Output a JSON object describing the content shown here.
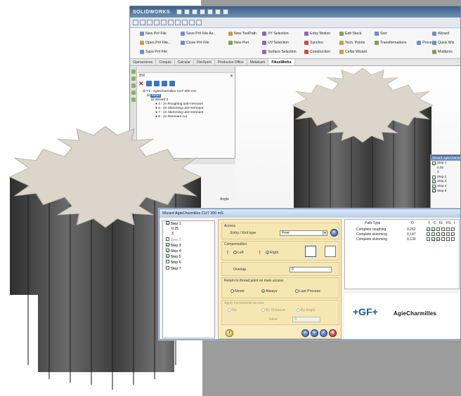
{
  "app": {
    "brand": "SOLIDWORKS"
  },
  "ribbon": {
    "items": [
      {
        "label": "New Pr# File"
      },
      {
        "label": "Save Pr# File As..."
      },
      {
        "label": "New ToolPath"
      },
      {
        "label": "XY Selection"
      },
      {
        "label": "Entry Motion"
      },
      {
        "label": "Edit Stock"
      },
      {
        "label": "Sort"
      },
      {
        "label": "Wizard"
      },
      {
        "label": "Open Pr# File..."
      },
      {
        "label": "Close Pr# File"
      },
      {
        "label": "New Part"
      },
      {
        "label": "UV Selection"
      },
      {
        "label": "Synchro"
      },
      {
        "label": "Tech. Points"
      },
      {
        "label": "Transformations"
      },
      {
        "label": "Process"
      },
      {
        "label": "Quick Wiz"
      },
      {
        "label": "Save Pr# File"
      },
      {
        "label": "Surface Selection"
      },
      {
        "label": "Construction"
      },
      {
        "label": "Cellar Wizard"
      },
      {
        "label": "Multiproc"
      }
    ]
  },
  "tabs": [
    {
      "label": "Operaciones"
    },
    {
      "label": "Croquis"
    },
    {
      "label": "Calcular"
    },
    {
      "label": "DimXpert"
    },
    {
      "label": "Productos Office"
    },
    {
      "label": "Metalcam"
    },
    {
      "label": "FikusWorks",
      "active": true
    }
  ],
  "tree": {
    "caption": "BW",
    "items": [
      {
        "label": "T1 - AgieCharmilles CUT 300 mS",
        "level": 0
      },
      {
        "label": "Step1",
        "level": 1
      },
      {
        "label": "Wizard 3",
        "level": 2
      },
      {
        "label": "4 - 2n Roughing unit+remnant",
        "level": 3
      },
      {
        "label": "5 - 2n Skimming unit+remnant",
        "level": 3
      },
      {
        "label": "7 - 2n Skimming unit+remnant",
        "level": 3
      },
      {
        "label": "8 - 2n Remnant cut",
        "level": 3
      }
    ]
  },
  "inspector": {
    "caption": "Inspector",
    "tab": "Details",
    "angle_label": "Angle"
  },
  "mini_wizard": {
    "title": "Wizard AgieCharmilles CUT 300 mS",
    "steps": [
      {
        "label": "Step 1",
        "checked": true
      },
      {
        "label": "0,25"
      },
      {
        "label": "3"
      },
      {
        "label": "Step 2",
        "dim": true
      },
      {
        "label": "Step 3",
        "checked": true
      },
      {
        "label": "Step 4",
        "checked": true
      },
      {
        "label": "Step 5",
        "checked": true
      }
    ]
  },
  "wizard": {
    "title": "Wizard AgieCharmilles CUT 300 mS",
    "steps": [
      {
        "label": "Step 1",
        "checked": true
      },
      {
        "label": "0,25"
      },
      {
        "label": "3"
      },
      {
        "label": "Step 2",
        "dim": true
      },
      {
        "label": "Step 3",
        "checked": true
      },
      {
        "label": "Step 4",
        "checked": true
      },
      {
        "label": "Step 5",
        "checked": true
      },
      {
        "label": "Step 6",
        "checked": false
      },
      {
        "label": "Step 7",
        "checked": false
      }
    ],
    "access": {
      "group": "Access",
      "entry_label": "Entry / Exit type",
      "entry_value": "Free"
    },
    "compensation": {
      "group": "Compensation",
      "left": "Left",
      "right": "Right"
    },
    "overlap": {
      "label": "Overlap",
      "value": "0"
    },
    "return": {
      "group": "Return to thread point on main access",
      "never": "Never",
      "always": "Always",
      "last": "Last Process"
    },
    "incremental": {
      "group": "Apply incremental access",
      "no": "No",
      "by_distance": "By Distance",
      "by_angle": "By Angle",
      "value_label": "Value",
      "value": "0"
    },
    "table": {
      "headers": [
        "Path Type",
        "O",
        "T",
        "C",
        "IS",
        "FS",
        "I"
      ],
      "rows": [
        {
          "path": "Complete roughing",
          "o": "0,262"
        },
        {
          "path": "Complete skimming",
          "o": "0,147"
        },
        {
          "path": "Complete skimming",
          "o": "0,133"
        }
      ]
    },
    "brand": {
      "gf": "+GF+",
      "name": "AgieCharmilles"
    }
  }
}
